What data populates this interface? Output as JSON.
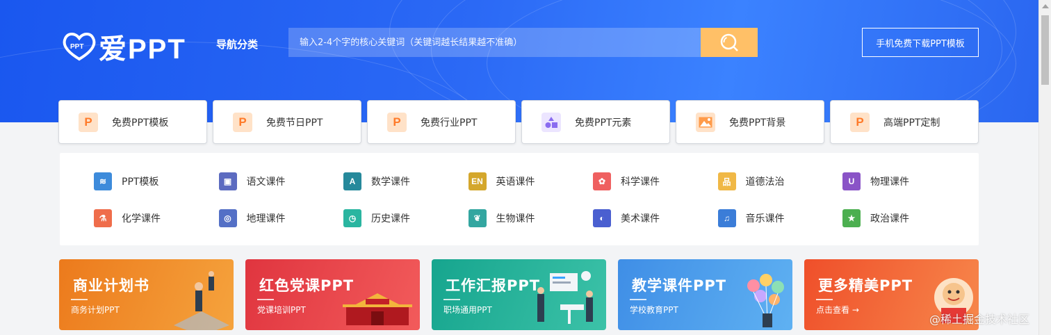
{
  "header": {
    "logo_text": "爱PPT",
    "logo_mark_text": "PPT",
    "nav_category": "导航分类",
    "search_placeholder": "输入2-4个字的核心关键词（关键词越长结果越不准确）",
    "download_button": "手机免费下载PPT模板",
    "accent_color": "#ffc067",
    "brand_color": "#1a57ef"
  },
  "categories": [
    {
      "label": "免费PPT模板",
      "icon": "P",
      "icon_name": "ppt-p-icon",
      "color": "#ffe2c8",
      "fg": "#ff7a29"
    },
    {
      "label": "免费节日PPT",
      "icon": "P",
      "icon_name": "ppt-p-icon",
      "color": "#ffe2c8",
      "fg": "#ff7a29"
    },
    {
      "label": "免费行业PPT",
      "icon": "P",
      "icon_name": "ppt-p-icon",
      "color": "#ffe2c8",
      "fg": "#ff7a29"
    },
    {
      "label": "免费PPT元素",
      "icon": "",
      "icon_name": "shapes-icon",
      "color": "#ece5ff",
      "fg": "#8a6cf0"
    },
    {
      "label": "免费PPT背景",
      "icon": "",
      "icon_name": "image-icon",
      "color": "#ffe2c8",
      "fg": "#ff7a29"
    },
    {
      "label": "高端PPT定制",
      "icon": "P",
      "icon_name": "ppt-p-icon",
      "color": "#ffe2c8",
      "fg": "#ff7a29"
    }
  ],
  "subjects": [
    {
      "label": "PPT模板",
      "icon_name": "layers-icon",
      "color": "#3d8bdb",
      "glyph": "≋"
    },
    {
      "label": "语文课件",
      "icon_name": "book-icon",
      "color": "#5c6bc0",
      "glyph": "▣"
    },
    {
      "label": "数学课件",
      "icon_name": "compass-icon",
      "color": "#26899b",
      "glyph": "A"
    },
    {
      "label": "英语课件",
      "icon_name": "en-icon",
      "color": "#d4a72c",
      "glyph": "EN"
    },
    {
      "label": "科学课件",
      "icon_name": "atom-icon",
      "color": "#ef6060",
      "glyph": "✿"
    },
    {
      "label": "道德法治",
      "icon_name": "board-icon",
      "color": "#f0b846",
      "glyph": "品"
    },
    {
      "label": "物理课件",
      "icon_name": "magnet-icon",
      "color": "#8a54c7",
      "glyph": "U"
    },
    {
      "label": "化学课件",
      "icon_name": "flask-icon",
      "color": "#ef6d4b",
      "glyph": "⚗"
    },
    {
      "label": "地理课件",
      "icon_name": "globe-icon",
      "color": "#5470c6",
      "glyph": "◎"
    },
    {
      "label": "历史课件",
      "icon_name": "history-icon",
      "color": "#2ab5a0",
      "glyph": "◷"
    },
    {
      "label": "生物课件",
      "icon_name": "leaf-icon",
      "color": "#33a6a0",
      "glyph": "❦"
    },
    {
      "label": "美术课件",
      "icon_name": "palette-icon",
      "color": "#4a5fd0",
      "glyph": "◐"
    },
    {
      "label": "音乐课件",
      "icon_name": "music-icon",
      "color": "#3b7dd8",
      "glyph": "♫"
    },
    {
      "label": "政治课件",
      "icon_name": "star-icon",
      "color": "#4caf50",
      "glyph": "★"
    }
  ],
  "banners": [
    {
      "title": "商业计划书",
      "sub": "商务计划PPT",
      "c1": "#ec7a1c",
      "c2": "#f5a33d"
    },
    {
      "title": "红色党课PPT",
      "sub": "党课培训PPT",
      "c1": "#e0353f",
      "c2": "#f25b5b"
    },
    {
      "title": "工作汇报PPT",
      "sub": "职场通用PPT",
      "c1": "#16a58e",
      "c2": "#3cc2a8"
    },
    {
      "title": "教学课件PPT",
      "sub": "学校教育PPT",
      "c1": "#3f8ee6",
      "c2": "#5fb1f2"
    },
    {
      "title": "更多精美PPT",
      "sub": "点击查看 →",
      "c1": "#ef4f2a",
      "c2": "#f7874b"
    }
  ],
  "watermark": "@稀土掘金技术社区"
}
